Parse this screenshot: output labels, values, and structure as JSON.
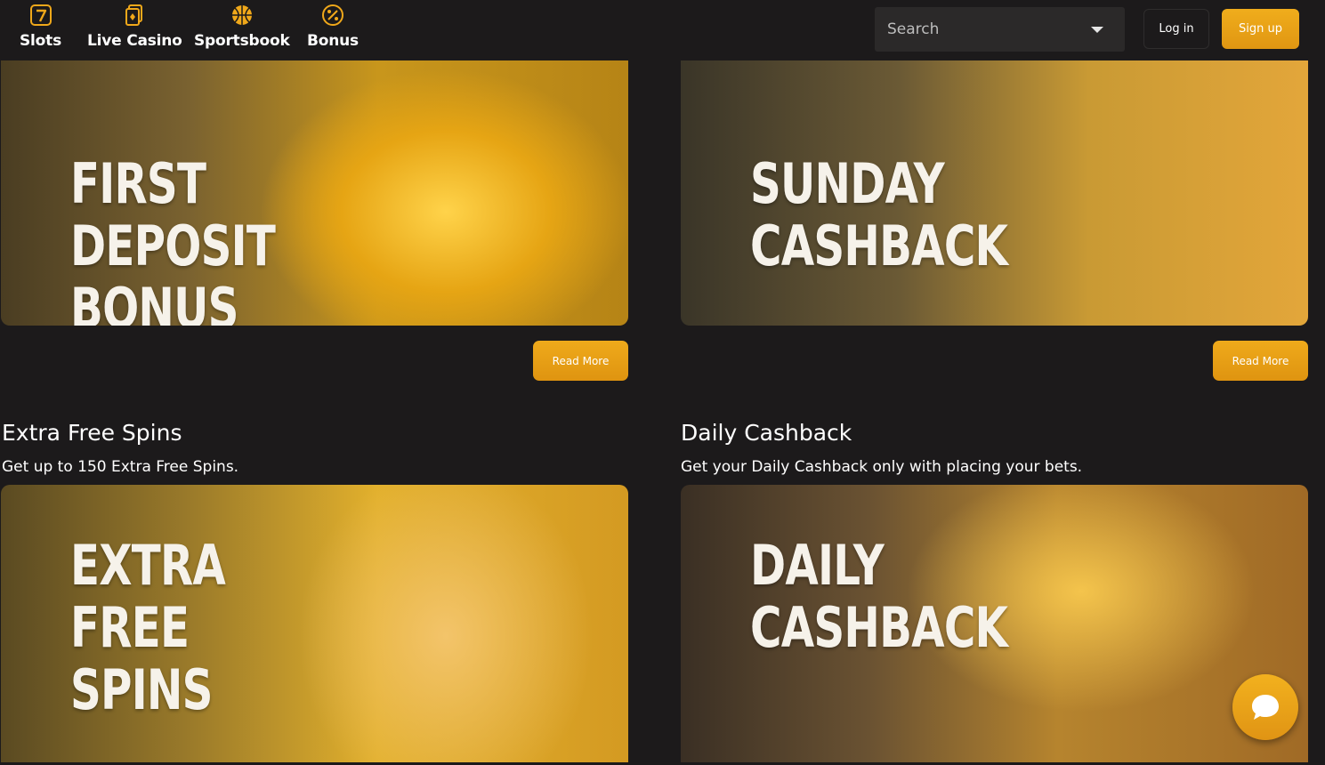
{
  "nav": {
    "items": [
      {
        "label": "Slots",
        "icon": "slots-seven-icon"
      },
      {
        "label": "Live Casino",
        "icon": "cards-icon"
      },
      {
        "label": "Sportsbook",
        "icon": "basketball-icon"
      },
      {
        "label": "Bonus",
        "icon": "percent-badge-icon"
      }
    ]
  },
  "header": {
    "search_placeholder": "Search",
    "login_label": "Log in",
    "signup_label": "Sign up"
  },
  "colors": {
    "accent": "#e8a11a",
    "background": "#1c1a1b"
  },
  "promos": [
    {
      "image_text": [
        "FIRST",
        "DEPOSIT",
        "BONUS"
      ],
      "read_more": "Read More"
    },
    {
      "image_text": [
        "SUNDAY",
        "CASHBACK"
      ],
      "read_more": "Read More"
    },
    {
      "title": "Extra Free Spins",
      "description": "Get up to 150 Extra Free Spins.",
      "image_text": [
        "EXTRA",
        "FREE",
        "SPINS"
      ]
    },
    {
      "title": "Daily Cashback",
      "description": "Get your Daily Cashback only with placing your bets.",
      "image_text": [
        "DAILY",
        "CASHBACK"
      ]
    }
  ],
  "chat": {
    "icon": "chat-bubble-icon"
  }
}
